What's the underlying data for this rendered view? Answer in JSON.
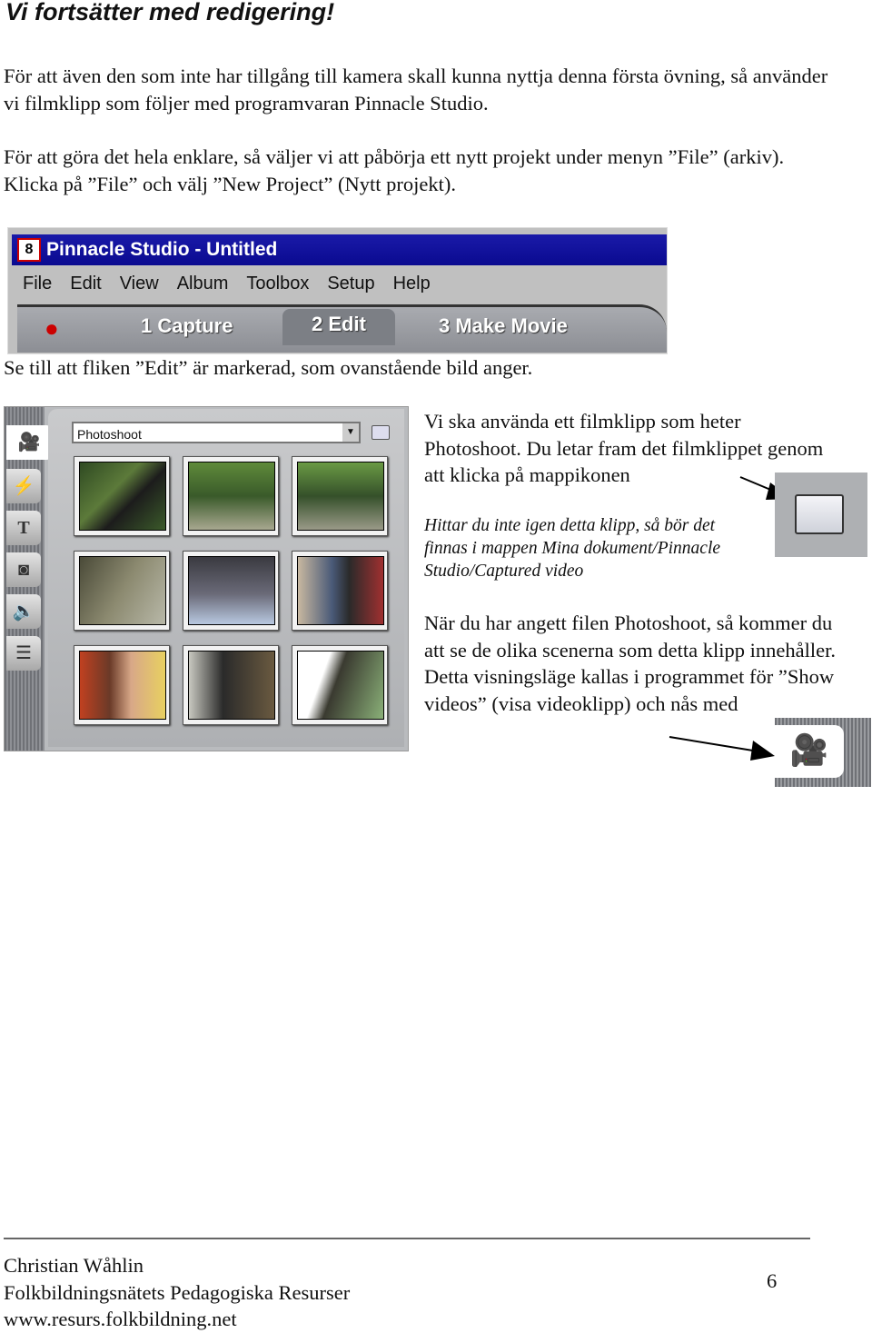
{
  "title": "Vi fortsätter med redigering!",
  "para1": "För att även den som inte har tillgång till kamera skall kunna nyttja denna första övning, så använder vi filmklipp som följer med programvaran Pinnacle Studio.",
  "para2": "För att göra det hela enklare, så väljer vi att påbörja ett nytt projekt under menyn ”File” (arkiv). Klicka på ”File” och välj ”New Project” (Nytt projekt).",
  "app": {
    "window_title": "Pinnacle Studio - Untitled",
    "menu": [
      "File",
      "Edit",
      "View",
      "Album",
      "Toolbox",
      "Setup",
      "Help"
    ],
    "modes": [
      "1 Capture",
      "2 Edit",
      "3 Make Movie"
    ],
    "active_mode": "2 Edit"
  },
  "caption": "Se till att fliken ”Edit” är markerad, som ovanstående bild anger.",
  "album": {
    "selected_clip": "Photoshoot",
    "side_tabs": [
      "video-camera-icon",
      "transitions-icon",
      "title-icon",
      "photo-icon",
      "sound-icon",
      "menu-disc-icon"
    ],
    "thumbnail_count": 9
  },
  "right": {
    "p1": "Vi ska använda ett filmklipp som heter Photoshoot. Du letar fram det filmklippet genom att klicka på mappikonen",
    "italic": "Hittar du inte igen detta klipp, så bör det finnas i mappen Mina dokument/Pinnacle Studio/Captured video",
    "p2": "När du har angett filen Photoshoot, så kommer du att se de olika scenerna som detta klipp innehåller. Detta visningsläge kallas i programmet för ”Show videos” (visa videoklipp) och nås med"
  },
  "footer": {
    "author": "Christian Wåhlin",
    "org": "Folkbildningsnätets Pedagogiska Resurser",
    "url": "www.resurs.folkbildning.net",
    "page": "6"
  },
  "colors": {
    "titlebar": "#0a0a90",
    "panel": "#b9bbbe"
  }
}
